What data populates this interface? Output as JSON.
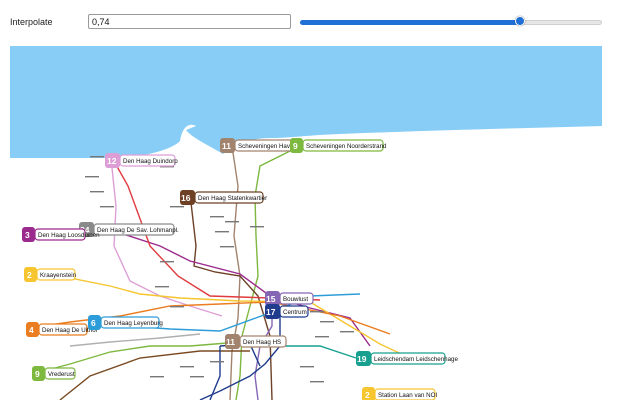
{
  "controls": {
    "interpolate_label": "Interpolate",
    "interpolate_value": "0,74",
    "slider_fraction": 0.73
  },
  "map": {
    "sea_color": "#88cdf6",
    "line_labels": [
      {
        "number": "12",
        "name": "Den Haag Duindorp",
        "color": "#dd9ed6"
      },
      {
        "number": "11",
        "name": "Scheveningen Haven",
        "color": "#a2836d"
      },
      {
        "number": "9",
        "name": "Scheveningen Noorderstrand",
        "color": "#7db83f"
      },
      {
        "number": "16",
        "name": "Den Haag Statenkwartier",
        "color": "#6e4126"
      },
      {
        "number": "34",
        "name": "Den Haag De Sav. Lohmanpl.",
        "color": "#8a8a8a"
      },
      {
        "number": "3",
        "name": "Den Haag Loosduinen",
        "color": "#9b2a8d"
      },
      {
        "number": "2",
        "name": "Kraayenstein",
        "color": "#f6c530"
      },
      {
        "number": "4",
        "name": "Den Haag De Uithof",
        "color": "#ea7d1f"
      },
      {
        "number": "6",
        "name": "Den Haag Leyenburg",
        "color": "#2d9dd9"
      },
      {
        "number": "9",
        "name": "Vrederust",
        "color": "#7db83f"
      },
      {
        "number": "15",
        "name": "Bouwlust",
        "color": "#8466b5"
      },
      {
        "number": "17",
        "name": "Centrum",
        "color": "#1f3c8d"
      },
      {
        "number": "11",
        "name": "Den Haag HS",
        "color": "#a2836d"
      },
      {
        "number": "19",
        "name": "Leidschendam Leidschenhage",
        "color": "#17a08f"
      },
      {
        "number": "2",
        "name": "Station Laan van NOI",
        "color": "#f6c530"
      }
    ]
  }
}
